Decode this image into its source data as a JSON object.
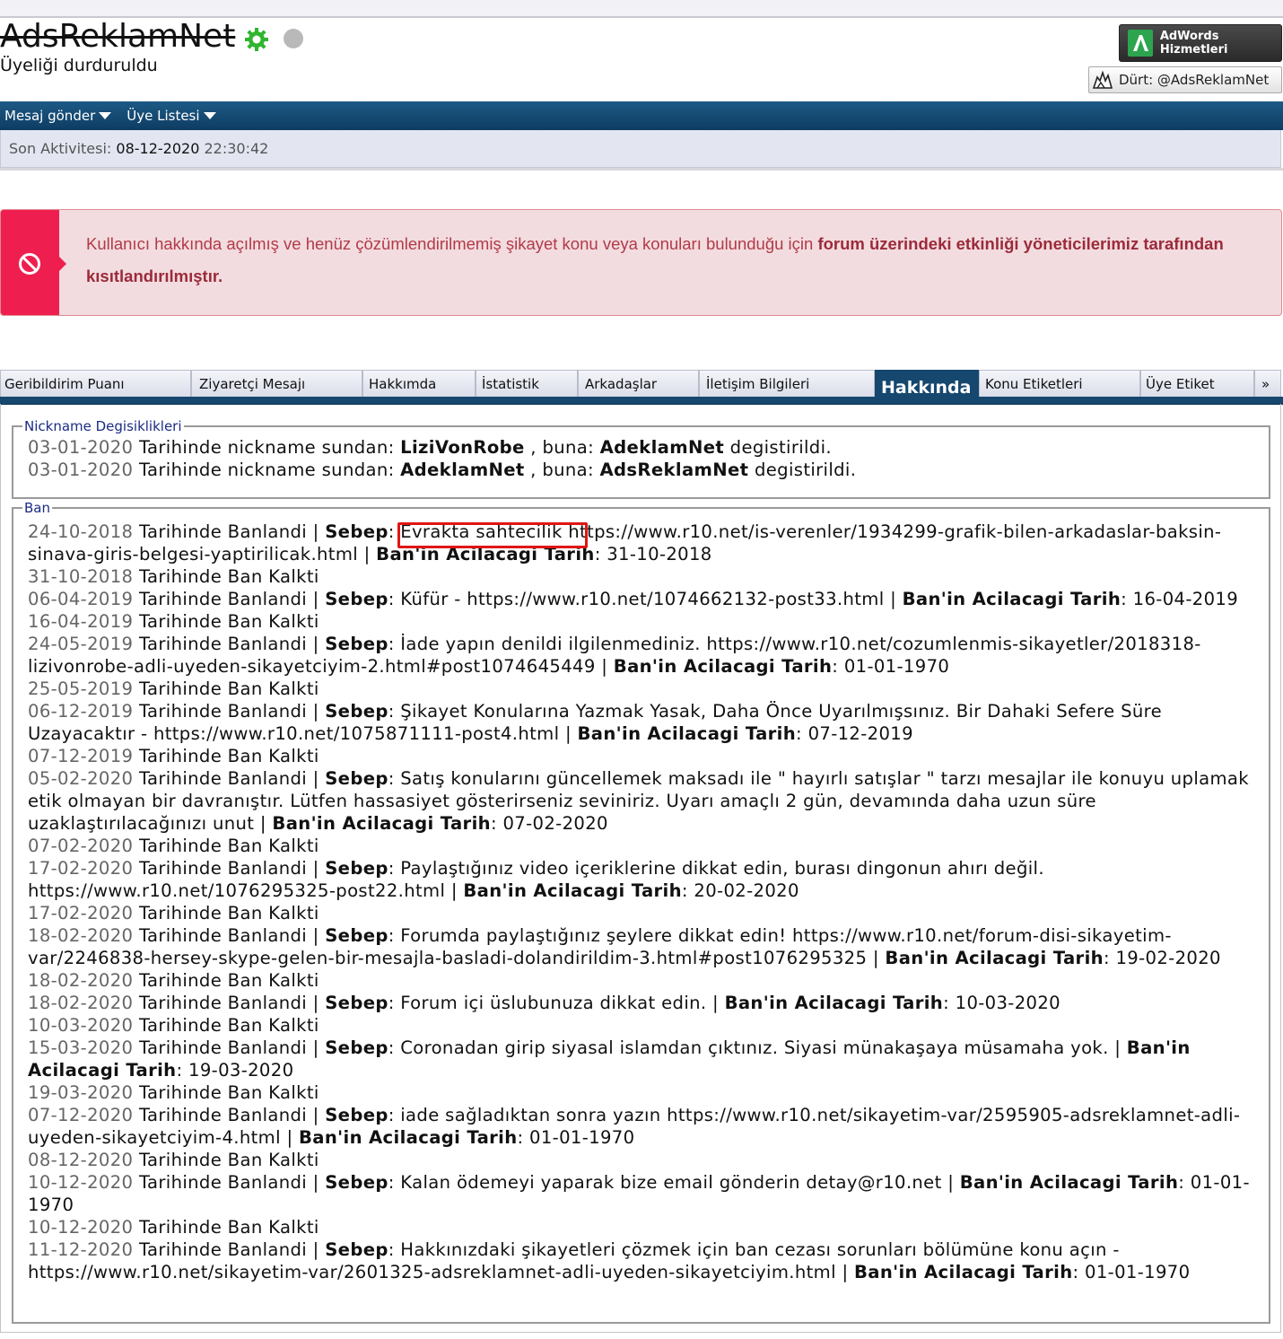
{
  "profile": {
    "username": "AdsReklamNet",
    "status": "Üyeliği durduruldu",
    "online_icon": "gear-online-icon",
    "offline_icon": "offline-dot-icon"
  },
  "actions": {
    "adwords_label": "AdWords Hizmetleri",
    "poke_label": "Dürt: @AdsReklamNet"
  },
  "navbar": {
    "items": [
      {
        "label": "Mesaj gönder"
      },
      {
        "label": "Üye Listesi"
      }
    ]
  },
  "activity": {
    "label": "Son Aktivitesi:",
    "date": "08-12-2020",
    "time": "22:30:42"
  },
  "alert": {
    "text": "Kullanıcı hakkında açılmış ve henüz çözümlendirilmemiş şikayet konu veya konuları bulunduğu için",
    "strong": "forum üzerindeki etkinliği yöneticilerimiz tarafından kısıtlandırılmıştır.",
    "color": "#ee1f4e"
  },
  "tabs": [
    {
      "label": "Geribildirim Puanı"
    },
    {
      "label": "Ziyaretçi Mesajı"
    },
    {
      "label": "Hakkımda"
    },
    {
      "label": "İstatistik"
    },
    {
      "label": "Arkadaşlar"
    },
    {
      "label": "İletişim Bilgileri"
    },
    {
      "label": "Hakkında",
      "active": true
    },
    {
      "label": "Konu Etiketleri"
    },
    {
      "label": "Üye Etiket"
    },
    {
      "label": "»"
    }
  ],
  "nick_changes": {
    "legend": "Nickname Degisiklikleri",
    "rows": [
      {
        "date": "03-01-2020",
        "mid": " Tarihinde nickname sundan: ",
        "from": "LiziVonRobe",
        "sep": " , buna: ",
        "to": "AdeklamNet",
        "tail": " degistirildi."
      },
      {
        "date": "03-01-2020",
        "mid": " Tarihinde nickname sundan: ",
        "from": "AdeklamNet",
        "sep": " , buna: ",
        "to": "AdsReklamNet",
        "tail": " degistirildi."
      }
    ]
  },
  "bans": {
    "legend": "Ban",
    "banned_text": " Tarihinde Banlandi | ",
    "lifted_text": " Tarihinde Ban Kalkti",
    "reason_label": "Sebep",
    "until_label": "Ban'in Acilacagi Tarih",
    "entries": [
      {
        "type": "ban",
        "date": "24-10-2018",
        "reason": "Evrakta sahtecilik https://www.r10.net/is-verenler/1934299-grafik-bilen-arkadaslar-baksin-sinava-giris-belgesi-yaptirilicak.html",
        "until": "31-10-2018"
      },
      {
        "type": "lift",
        "date": "31-10-2018"
      },
      {
        "type": "ban",
        "date": "06-04-2019",
        "reason": "Küfür - https://www.r10.net/1074662132-post33.html",
        "until": "16-04-2019"
      },
      {
        "type": "lift",
        "date": "16-04-2019"
      },
      {
        "type": "ban",
        "date": "24-05-2019",
        "reason": "İade yapın denildi ilgilenmediniz. https://www.r10.net/cozumlenmis-sikayetler/2018318-lizivonrobe-adli-uyeden-sikayetciyim-2.html#post1074645449",
        "until": "01-01-1970"
      },
      {
        "type": "lift",
        "date": "25-05-2019"
      },
      {
        "type": "ban",
        "date": "06-12-2019",
        "reason": "Şikayet Konularına Yazmak Yasak, Daha Önce Uyarılmışsınız. Bir Dahaki Sefere Süre Uzayacaktır - https://www.r10.net/1075871111-post4.html",
        "until": "07-12-2019"
      },
      {
        "type": "lift",
        "date": "07-12-2019"
      },
      {
        "type": "ban",
        "date": "05-02-2020",
        "reason": "Satış konularını güncellemek maksadı ile \" hayırlı satışlar \" tarzı mesajlar ile konuyu uplamak etik olmayan bir davranıştır. Lütfen hassasiyet gösterirseniz seviniriz. Uyarı amaçlı 2 gün, devamında daha uzun süre uzaklaştırılacağınızı unut",
        "until": "07-02-2020"
      },
      {
        "type": "lift",
        "date": "07-02-2020"
      },
      {
        "type": "ban",
        "date": "17-02-2020",
        "reason": "Paylaştığınız video içeriklerine dikkat edin, burası dingonun ahırı değil. https://www.r10.net/1076295325-post22.html",
        "until": "20-02-2020"
      },
      {
        "type": "lift",
        "date": "17-02-2020"
      },
      {
        "type": "ban",
        "date": "18-02-2020",
        "reason": "Forumda paylaştığınız şeylere dikkat edin! https://www.r10.net/forum-disi-sikayetim-var/2246838-hersey-skype-gelen-bir-mesajla-basladi-dolandirildim-3.html#post1076295325",
        "until": "19-02-2020"
      },
      {
        "type": "lift",
        "date": "18-02-2020"
      },
      {
        "type": "ban",
        "date": "18-02-2020",
        "reason": "Forum içi üslubunuza dikkat edin.",
        "until": "10-03-2020"
      },
      {
        "type": "lift",
        "date": "10-03-2020"
      },
      {
        "type": "ban",
        "date": "15-03-2020",
        "reason": "Coronadan girip siyasal islamdan çıktınız. Siyasi münakaşaya müsamaha yok.",
        "until": "19-03-2020"
      },
      {
        "type": "lift",
        "date": "19-03-2020"
      },
      {
        "type": "ban",
        "date": "07-12-2020",
        "reason": "iade sağladıktan sonra yazın https://www.r10.net/sikayetim-var/2595905-adsreklamnet-adli-uyeden-sikayetciyim-4.html",
        "until": "01-01-1970"
      },
      {
        "type": "lift",
        "date": "08-12-2020"
      },
      {
        "type": "ban",
        "date": "10-12-2020",
        "reason": "Kalan ödemeyi yaparak bize email gönderin detay@r10.net",
        "until": "01-01-1970"
      },
      {
        "type": "lift",
        "date": "10-12-2020"
      },
      {
        "type": "ban",
        "date": "11-12-2020",
        "reason": "Hakkınızdaki şikayetleri çözmek için ban cezası sorunları bölümüne konu açın - https://www.r10.net/sikayetim-var/2601325-adsreklamnet-adli-uyeden-sikayetciyim.html",
        "until": "01-01-1970"
      }
    ]
  },
  "colors": {
    "nav_blue": "#15476f",
    "highlight_red": "#e01515",
    "legend_blue": "#1b2b86"
  }
}
